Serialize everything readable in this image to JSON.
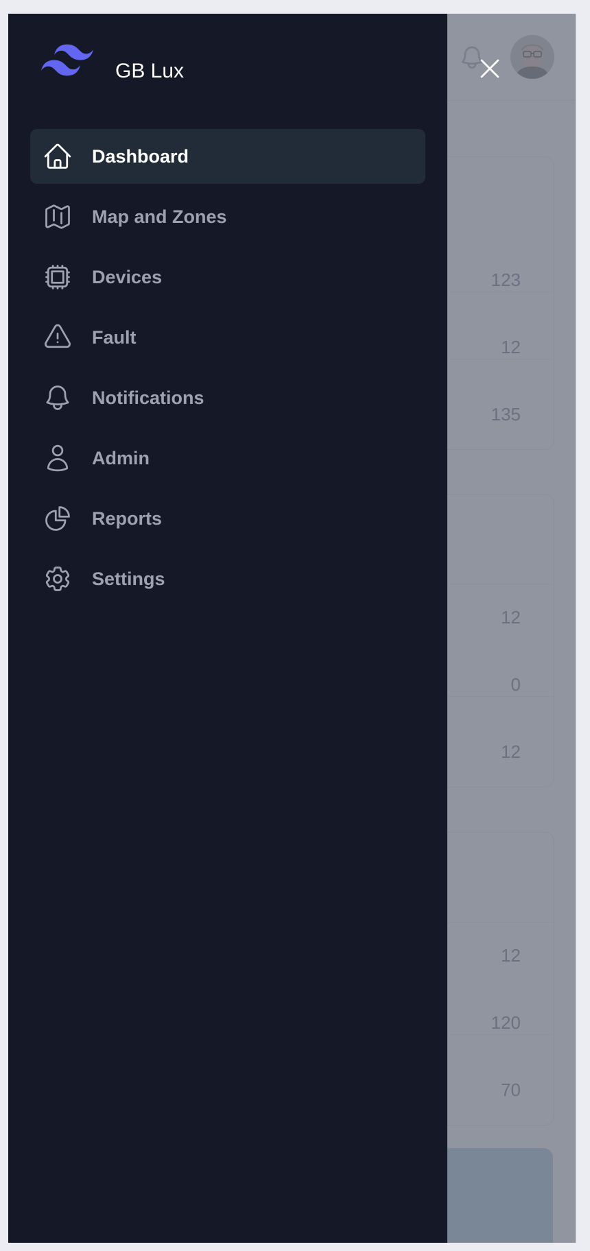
{
  "app": {
    "name": "GB Lux"
  },
  "nav": {
    "items": [
      {
        "label": "Dashboard",
        "icon": "home-icon",
        "active": true
      },
      {
        "label": "Map and Zones",
        "icon": "map-icon",
        "active": false
      },
      {
        "label": "Devices",
        "icon": "cpu-chip-icon",
        "active": false
      },
      {
        "label": "Fault",
        "icon": "warning-triangle-icon",
        "active": false
      },
      {
        "label": "Notifications",
        "icon": "bell-icon",
        "active": false
      },
      {
        "label": "Admin",
        "icon": "user-icon",
        "active": false
      },
      {
        "label": "Reports",
        "icon": "pie-chart-icon",
        "active": false
      },
      {
        "label": "Settings",
        "icon": "gear-icon",
        "active": false
      }
    ]
  },
  "background": {
    "card1": {
      "values": [
        "123",
        "12",
        "135"
      ]
    },
    "card2": {
      "values": [
        "12",
        "0",
        "12"
      ]
    },
    "card3": {
      "values": [
        "12",
        "120",
        "70"
      ]
    }
  },
  "colors": {
    "drawer_bg": "#141827",
    "active_item_bg": "#222b38",
    "logo_accent": "#6366f1",
    "inactive_label": "#9ca3af"
  }
}
